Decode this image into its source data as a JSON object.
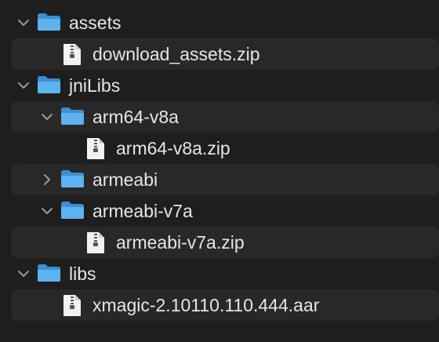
{
  "tree": {
    "rows": [
      {
        "kind": "folder",
        "label": "assets",
        "expanded": true
      },
      {
        "kind": "file",
        "label": "download_assets.zip"
      },
      {
        "kind": "folder",
        "label": "jniLibs",
        "expanded": true
      },
      {
        "kind": "folder",
        "label": "arm64-v8a",
        "expanded": true
      },
      {
        "kind": "file",
        "label": "arm64-v8a.zip"
      },
      {
        "kind": "folder",
        "label": "armeabi",
        "expanded": false
      },
      {
        "kind": "folder",
        "label": "armeabi-v7a",
        "expanded": true
      },
      {
        "kind": "file",
        "label": "armeabi-v7a.zip"
      },
      {
        "kind": "folder",
        "label": "libs",
        "expanded": true
      },
      {
        "kind": "file",
        "label": "xmagic-2.10110.110.444.aar"
      }
    ]
  },
  "colors": {
    "background": "#1e1e1e",
    "alt_row": "#282828",
    "folder": "#4aa3e6",
    "text": "#e6e6e6",
    "chevron": "#9a9a9a"
  },
  "icons": {
    "folder": "folder-icon",
    "file": "zip-file-icon",
    "expanded": "chevron-down-icon",
    "collapsed": "chevron-right-icon"
  }
}
